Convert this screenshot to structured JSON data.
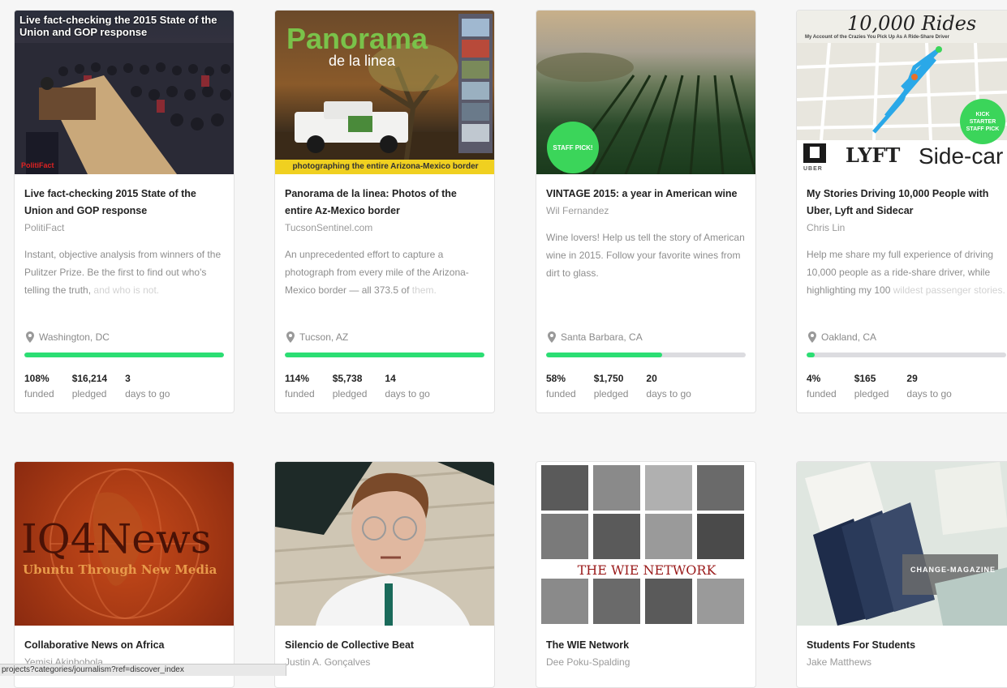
{
  "projects": [
    {
      "title": "Live fact-checking 2015 State of the Union and GOP response",
      "creator": "PolitiFact",
      "blurb": "Instant, objective analysis from winners of the Pulitzer Prize. Be the first to find out who's telling the truth,",
      "blurb_fade": "and who is not.",
      "location": "Washington, DC",
      "funded_pct": 100,
      "funded": "108%",
      "pledged": "$16,214",
      "days": "3",
      "image_caption": "Live fact-checking the 2015 State of the Union and GOP response",
      "image_logo": "PolitiFact"
    },
    {
      "title": "Panorama de la linea: Photos of the entire Az-Mexico border",
      "creator": "TucsonSentinel.com",
      "blurb": "An unprecedented effort to capture a photograph from every mile of the Arizona-Mexico border — all 373.5 of",
      "blurb_fade": "them.",
      "location": "Tucson, AZ",
      "funded_pct": 100,
      "funded": "114%",
      "pledged": "$5,738",
      "days": "14",
      "image_title": "Panorama",
      "image_subtitle": "de la linea",
      "image_caption": "photographing the entire Arizona-Mexico border"
    },
    {
      "title": "VINTAGE 2015: a year in American wine",
      "creator": "Wil Fernandez",
      "blurb": "Wine lovers! Help us tell the story of American wine in 2015. Follow your favorite wines from dirt to glass.",
      "blurb_fade": "",
      "location": "Santa Barbara, CA",
      "funded_pct": 58,
      "funded": "58%",
      "pledged": "$1,750",
      "days": "20",
      "badge": "STAFF PICK!"
    },
    {
      "title": "My Stories Driving 10,000 People with Uber, Lyft and Sidecar",
      "creator": "Chris Lin",
      "blurb": "Help me share my full experience of driving 10,000 people as a ride-share driver, while highlighting my 100",
      "blurb_fade": "wildest passenger stories.",
      "location": "Oakland, CA",
      "funded_pct": 4,
      "funded": "4%",
      "pledged": "$165",
      "days": "29",
      "image_title": "10,000 Rides",
      "image_subtitle": "My Account of the Crazies You Pick Up As A Ride-Share Driver",
      "badge": "KICK STARTER STAFF PICK",
      "logo_uber": "UBER",
      "logo_lyft": "LYFT",
      "logo_sidecar": "Side-car"
    },
    {
      "title": "Collaborative News on Africa",
      "creator": "Yemisi Akinbobola",
      "image_title": "IQ4News",
      "image_subtitle": "Ubuntu Through New Media"
    },
    {
      "title": "Silencio de Collective Beat",
      "creator": "Justin A. Gonçalves"
    },
    {
      "title": "The WIE Network",
      "creator": "Dee Poku-Spalding",
      "image_title": "THE WIE NETWORK"
    },
    {
      "title": "Students For Students",
      "creator": "Jake Matthews",
      "image_caption": "CHANGE-MAGAZINE"
    }
  ],
  "labels": {
    "funded": "funded",
    "pledged": "pledged",
    "days": "days to go"
  },
  "status_bar": "projects?categories/journalism?ref=discover_index",
  "colors": {
    "progress": "#2bde73",
    "track": "#dcdce0",
    "staff_pick": "#3bd55a"
  }
}
